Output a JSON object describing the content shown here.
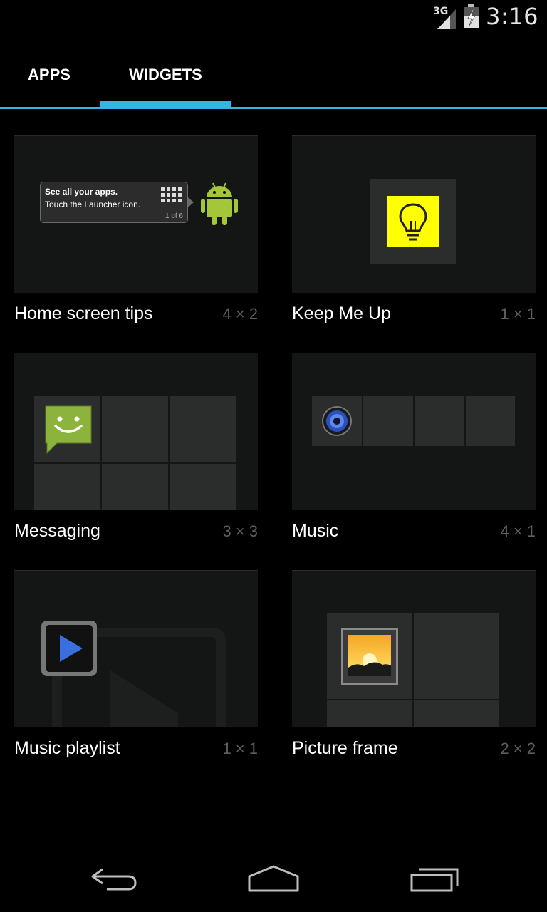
{
  "status_bar": {
    "network": "3G",
    "time": "3:16"
  },
  "tabs": [
    {
      "label": "APPS",
      "selected": false
    },
    {
      "label": "WIDGETS",
      "selected": true
    }
  ],
  "colors": {
    "accent": "#33b5e5",
    "background": "#000000",
    "preview_background": "#141615",
    "dims_text": "#5e5e5e"
  },
  "widgets": [
    {
      "name": "Home screen tips",
      "dims": "4 × 2",
      "icon": "android-robot-icon",
      "preview": {
        "line1": "See all your apps.",
        "line2": "Touch the Launcher icon.",
        "page": "1 of 6"
      }
    },
    {
      "name": "Keep Me Up",
      "dims": "1 × 1",
      "icon": "lightbulb-icon"
    },
    {
      "name": "Messaging",
      "dims": "3 × 3",
      "icon": "messaging-smiley-icon"
    },
    {
      "name": "Music",
      "dims": "4 × 1",
      "icon": "speaker-icon"
    },
    {
      "name": "Music playlist",
      "dims": "1 × 1",
      "icon": "play-button-icon"
    },
    {
      "name": "Picture frame",
      "dims": "2 × 2",
      "icon": "picture-frame-icon"
    }
  ],
  "nav_bar": [
    {
      "icon": "back-icon"
    },
    {
      "icon": "home-icon"
    },
    {
      "icon": "recent-apps-icon"
    }
  ]
}
